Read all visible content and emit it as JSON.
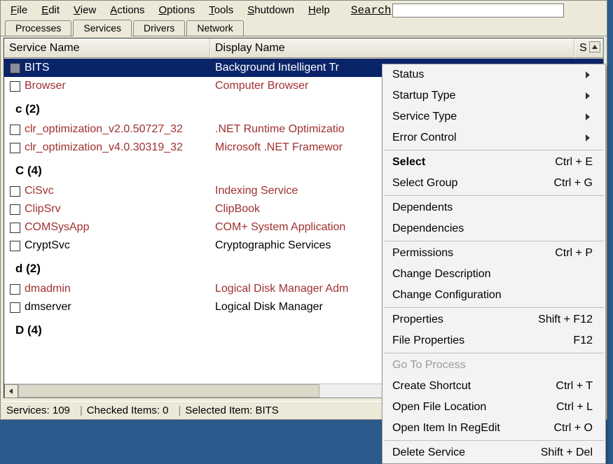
{
  "menubar": [
    "File",
    "Edit",
    "View",
    "Actions",
    "Options",
    "Tools",
    "Shutdown",
    "Help"
  ],
  "search": {
    "label": "Search",
    "value": ""
  },
  "tabs": [
    {
      "label": "Processes",
      "active": false
    },
    {
      "label": "Services",
      "active": true
    },
    {
      "label": "Drivers",
      "active": false
    },
    {
      "label": "Network",
      "active": false
    }
  ],
  "columns": [
    "Service Name",
    "Display Name",
    "S"
  ],
  "rowsdefs": [
    {
      "type": "row",
      "selected": true,
      "red": true,
      "name": "BITS",
      "display": "Background Intelligent Tr"
    },
    {
      "type": "row",
      "red": true,
      "name": "Browser",
      "display": "Computer Browser"
    },
    {
      "type": "group",
      "label": "c (2)"
    },
    {
      "type": "row",
      "red": true,
      "name": "clr_optimization_v2.0.50727_32",
      "display": ".NET Runtime Optimizatio"
    },
    {
      "type": "row",
      "red": true,
      "name": "clr_optimization_v4.0.30319_32",
      "display": "Microsoft .NET Framewor"
    },
    {
      "type": "group",
      "label": "C (4)"
    },
    {
      "type": "row",
      "red": true,
      "name": "CiSvc",
      "display": "Indexing Service"
    },
    {
      "type": "row",
      "red": true,
      "name": "ClipSrv",
      "display": "ClipBook"
    },
    {
      "type": "row",
      "red": true,
      "name": "COMSysApp",
      "display": "COM+ System Application"
    },
    {
      "type": "row",
      "red": false,
      "name": "CryptSvc",
      "display": "Cryptographic Services"
    },
    {
      "type": "group",
      "label": "d (2)"
    },
    {
      "type": "row",
      "red": true,
      "name": "dmadmin",
      "display": "Logical Disk Manager Adm"
    },
    {
      "type": "row",
      "red": false,
      "name": "dmserver",
      "display": "Logical Disk Manager"
    },
    {
      "type": "group",
      "label": "D (4)"
    }
  ],
  "status": {
    "services": "Services: 109",
    "checked": "Checked Items: 0",
    "selected": "Selected Item: BITS"
  },
  "context_menu": [
    {
      "label": "Status",
      "sub": true
    },
    {
      "label": "Startup Type",
      "sub": true
    },
    {
      "label": "Service Type",
      "sub": true
    },
    {
      "label": "Error Control",
      "sub": true
    },
    {
      "sep": true
    },
    {
      "label": "Select",
      "shortcut": "Ctrl + E",
      "bold": true
    },
    {
      "label": "Select Group",
      "shortcut": "Ctrl + G"
    },
    {
      "sep": true
    },
    {
      "label": "Dependents"
    },
    {
      "label": "Dependencies"
    },
    {
      "sep": true
    },
    {
      "label": "Permissions",
      "shortcut": "Ctrl + P"
    },
    {
      "label": "Change Description"
    },
    {
      "label": "Change Configuration"
    },
    {
      "sep": true
    },
    {
      "label": "Properties",
      "shortcut": "Shift + F12"
    },
    {
      "label": "File Properties",
      "shortcut": "F12"
    },
    {
      "sep": true
    },
    {
      "label": "Go To Process",
      "disabled": true
    },
    {
      "label": "Create Shortcut",
      "shortcut": "Ctrl + T"
    },
    {
      "label": "Open File Location",
      "shortcut": "Ctrl + L"
    },
    {
      "label": "Open Item In RegEdit",
      "shortcut": "Ctrl + O"
    },
    {
      "sep": true
    },
    {
      "label": "Delete Service",
      "shortcut": "Shift + Del"
    }
  ]
}
